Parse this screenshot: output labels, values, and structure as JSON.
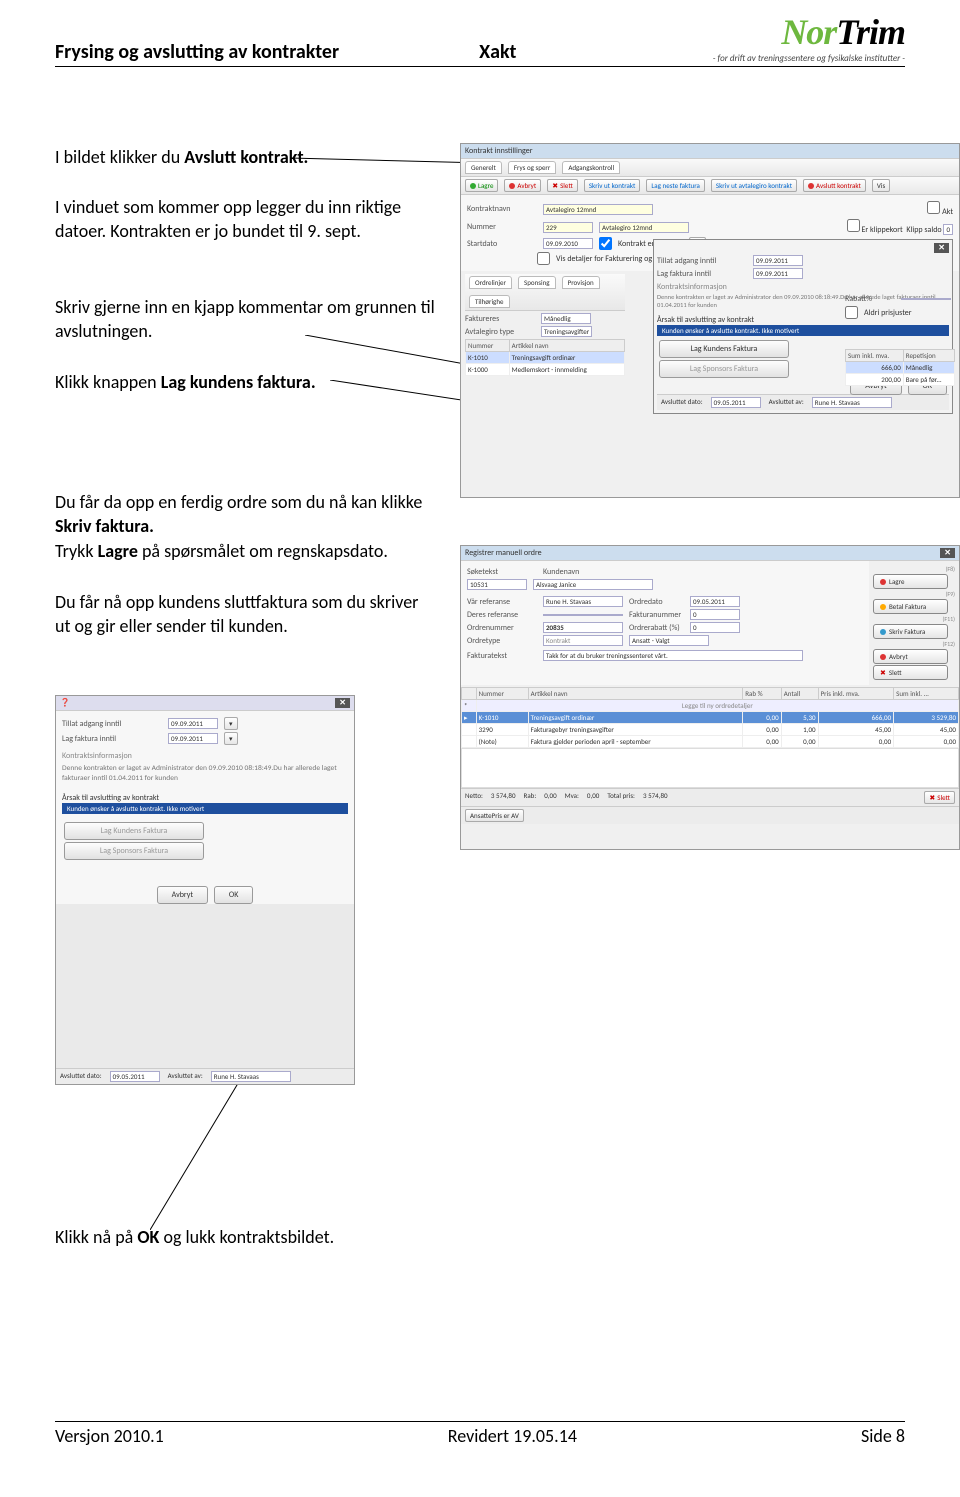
{
  "header": {
    "left": "Frysing og avslutting av kontrakter",
    "mid": "Xakt",
    "logo_green": "Nor",
    "logo_black": "Trim",
    "logo_sub": "- for drift av treningssentere og fysikalske institutter -"
  },
  "para": {
    "p1a": "I bildet klikker du ",
    "p1b": "Avslutt kontrakt.",
    "p2": "I vinduet som kommer opp legger du inn riktige datoer. Kontrakten er jo bundet til 9. sept.",
    "p3": "Skriv gjerne inn en kjapp kommentar om grunnen til avslutningen.",
    "p4a": "Klikk knappen ",
    "p4b": "Lag kundens faktura.",
    "p5a": "Du får da opp en ferdig ordre som du nå kan klikke  ",
    "p5b": "Skriv faktura. ",
    "p5c": "Trykk ",
    "p5d": "Lagre",
    "p5e": " på spørsmålet om regnskapsdato.",
    "p6": "Du får nå opp kundens sluttfaktura som du skriver ut og gir eller sender til kunden.",
    "p7a": "Klikk nå på ",
    "p7b": "OK ",
    "p7c": " og lukk kontraktsbildet."
  },
  "ss1": {
    "title": "Kontrakt innstillinger",
    "tabs": [
      "Generelt",
      "Frys og sperr",
      "Adgangskontroll"
    ],
    "toolbar": [
      "Lagre",
      "Avbryt",
      "Slett",
      "Skriv ut kontrakt",
      "Lag neste faktura",
      "Skriv ut avtalegiro kontrakt",
      "Avslutt kontrakt",
      "Vis"
    ],
    "kontrakttype_lbl": "Kontraktnavn",
    "kontrakttype_val": "Avtalegiro 12mnd",
    "akt": "Akt",
    "nummer_lbl": "Nummer",
    "nummer_val": "229",
    "nummer_desc": "Avtalegiro 12mnd",
    "klipp_lbl": "Er klippekort",
    "klipp_saldo_lbl": "Klipp saldo",
    "klipp_saldo_val": "0",
    "startdato_lbl": "Startdato",
    "startdato_val": "09.09.2010",
    "kontrakt_ender": "Kontrakt ender aldri",
    "detaljer": "Vis detaljer for Fakturering og Adgang - Start og",
    "tabs2": [
      "Ordrelinjer",
      "Sponsing",
      "Provisjon",
      "Tilhørighe"
    ],
    "tillat_lbl": "Tillat adgang inntil",
    "tillat_val": "09.09.2011",
    "lagfakt_lbl": "Lag faktura inntil",
    "lagfakt_val": "09.09.2011",
    "faktureres_lbl": "Faktureres",
    "faktureres_val": "Månedlig",
    "avtype_lbl": "Avtalegiro type",
    "avtype_val": "Treningsavgifter",
    "rabatt_lbl": "Rabatt%",
    "aldri": "Aldri prisjuster",
    "kinfo_lbl": "Kontraktsinformasjon",
    "kinfo_txt": "Denne kontrakten er laget av Administrator den 09.09.2010 08:18:49.Du har allerede laget fakturaer inntil 01.04.2011 for kunden",
    "aarsak_lbl": "Årsak til avslutting av kontrakt",
    "aarsak_val": "Kunden ønsker å avslutte kontrakt. Ikke motivert",
    "th": [
      "Nummer",
      "Artikkel navn"
    ],
    "th2": [
      "Sum inkl. mva.",
      "Repetisjon"
    ],
    "r1n": "K-1010",
    "r1a": "Treningsavgift ordinær",
    "r1s": "666,00",
    "r1r": "Månedlig",
    "r2n": "K-1000",
    "r2a": "Medlemskort - innmelding",
    "r2s": "200,00",
    "r2r": "Bare på før...",
    "btn_lagkunde": "Lag Kundens Faktura",
    "btn_lagspons": "Lag Sponsors Faktura",
    "btn_avbryt": "Avbryt",
    "btn_ok": "OK",
    "avsl_dato_lbl": "Avsluttet dato:",
    "avsl_dato_val": "09.05.2011",
    "avsl_av_lbl": "Avsluttet av:",
    "avsl_av_val": "Rune H. Stavaas"
  },
  "ss2": {
    "title": "Registrer manuell ordre",
    "soketekst_lbl": "Søketekst",
    "kundenavn_lbl": "Kundenavn",
    "sokval": "10531",
    "kundenavn": "Alsvaag Janice",
    "ref_lbl": "Vår referanse",
    "ref_val": "Rune H. Stavaas",
    "deres_lbl": "Deres referanse",
    "ordredato_lbl": "Ordredato",
    "ordredato_val": "09.05.2011",
    "faktnr_lbl": "Fakturanummer",
    "faktnr_val": "0",
    "ordrenr_lbl": "Ordrenummer",
    "ordrenr_val": "20835",
    "rabatt_lbl": "Ordrerabatt (%)",
    "rabatt_val": "0",
    "ordretype_lbl": "Ordretype",
    "ordretype_val": "Kontrakt",
    "ansatt_val": "Ansatt - Valgt",
    "fakttekst_lbl": "Fakturatekst",
    "fakttekst_val": "Takk for at du bruker treningssenteret vårt.",
    "btn_lagre": "Lagre",
    "btn_lagre_k": "(F8)",
    "btn_betal": "Betal Faktura",
    "btn_betal_k": "(F9)",
    "btn_skriv": "Skriv Faktura",
    "btn_skriv_k": "(F11)",
    "btn_avbryt": "Avbryt",
    "btn_avbryt_k": "(F12)",
    "btn_slett": "Slett",
    "th": [
      "Nummer",
      "Artikkel navn",
      "Rab %",
      "Antall",
      "Pris inkl. mva.",
      "Sum inkl. ..."
    ],
    "legg": "Legge til ny ordredetaljer",
    "r1": [
      "K-1010",
      "Treningsavgift ordinær",
      "0,00",
      "5,30",
      "666,00",
      "3 529,80"
    ],
    "r2": [
      "3290",
      "Fakturagebyr treningsavgifter",
      "0,00",
      "1,00",
      "45,00",
      "45,00"
    ],
    "r3": [
      "(Note)",
      "Faktura gjelder perioden april - september",
      "0,00",
      "0,00",
      "0,00",
      "0,00"
    ],
    "netto_lbl": "Netto:",
    "netto": "3 574,80",
    "rab_lbl": "Rab:",
    "rab": "0,00",
    "mva_lbl": "Mva:",
    "mva": "0,00",
    "total_lbl": "Total pris:",
    "total": "3 574,80",
    "slett": "Slett",
    "ansatte": "AnsattePris er AV"
  },
  "ss3": {
    "tillat_lbl": "Tillat adgang inntil",
    "tillat_val": "09.09.2011",
    "lagfakt_lbl": "Lag faktura inntil",
    "lagfakt_val": "09.09.2011",
    "kinfo_lbl": "Kontraktsinformasjon",
    "kinfo_txt": "Denne kontrakten er laget av Administrator den 09.09.2010 08:18:49.Du har allerede laget fakturaer inntil 01.04.2011 for kunden",
    "aarsak_lbl": "Årsak til avslutting av kontrakt",
    "aarsak_val": "Kunden ønsker å avslutte kontrakt. Ikke motivert",
    "btn_lagkunde": "Lag Kundens Faktura",
    "btn_lagspons": "Lag Sponsors Faktura",
    "btn_avbryt": "Avbryt",
    "btn_ok": "OK",
    "avsl_dato_lbl": "Avsluttet dato:",
    "avsl_dato_val": "09.05.2011",
    "avsl_av_lbl": "Avsluttet av:",
    "avsl_av_val": "Rune H. Stavaas"
  },
  "footer": {
    "left": "Versjon 2010.1",
    "mid": "Revidert 19.05.14",
    "right": "Side 8"
  }
}
